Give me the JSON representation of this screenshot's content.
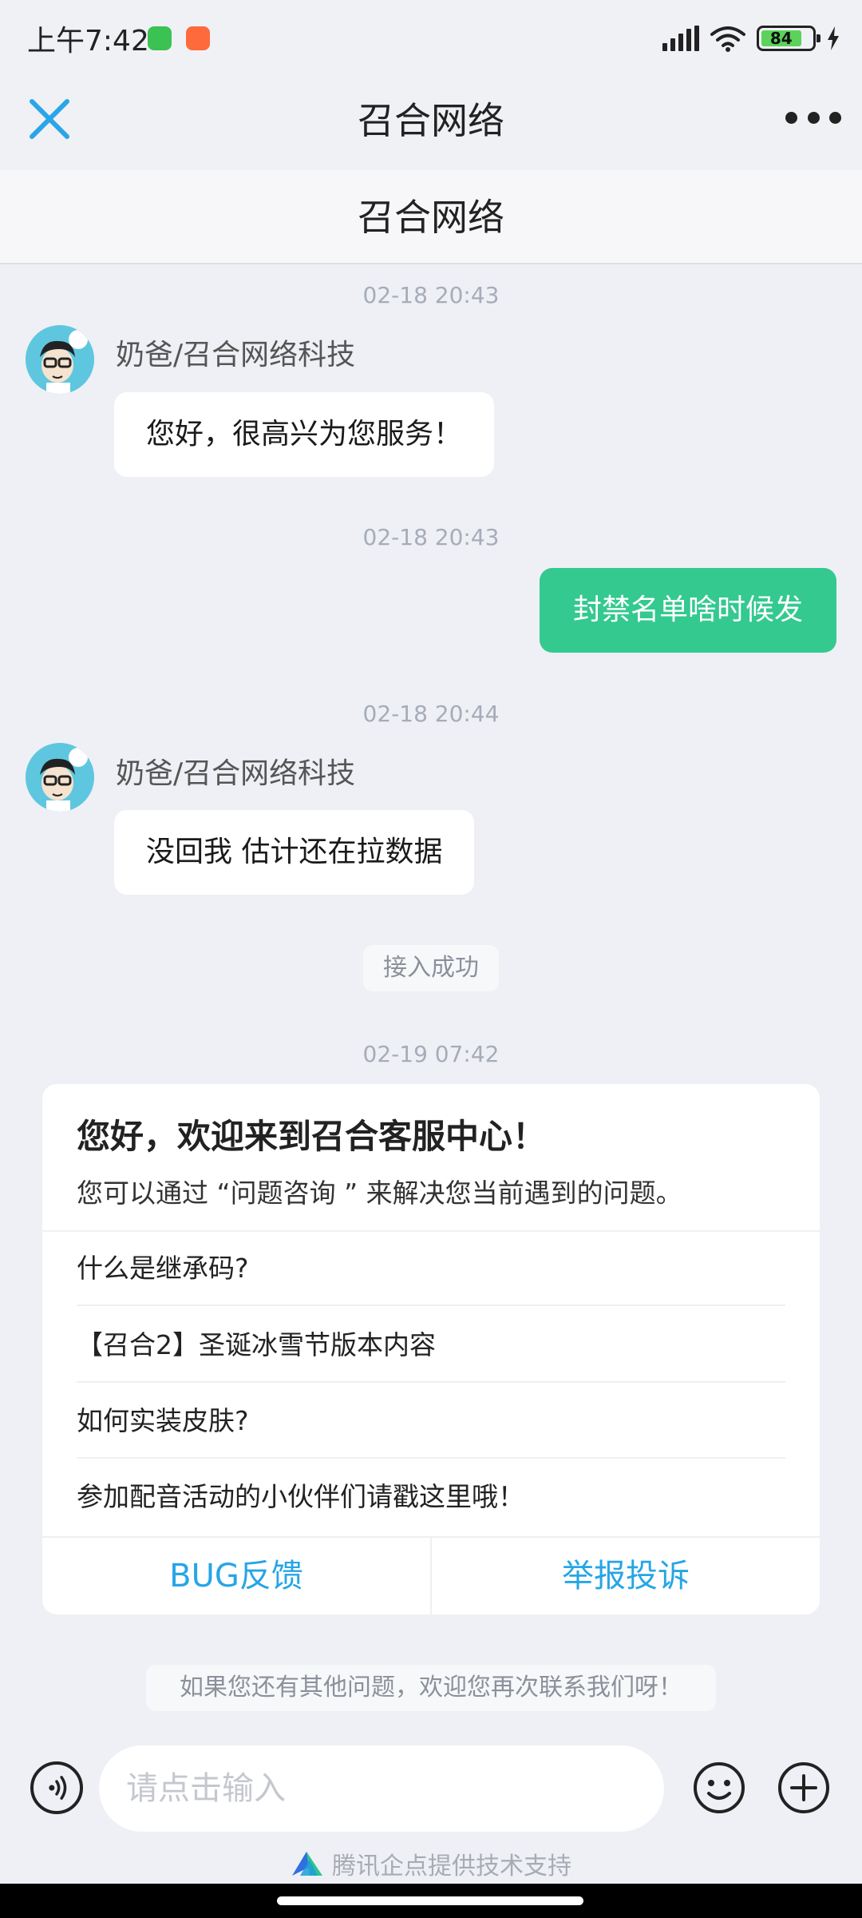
{
  "status": {
    "time": "上午7:42",
    "battery": "84"
  },
  "appbar": {
    "title": "召合网络"
  },
  "subheader": {
    "title": "召合网络"
  },
  "messages": [
    {
      "timestamp": "02-18 20:43",
      "sender": "奶爸/召合网络科技",
      "text": "您好，很高兴为您服务！"
    },
    {
      "timestamp": "02-18 20:43",
      "text": "封禁名单啥时候发"
    },
    {
      "timestamp": "02-18 20:44",
      "sender": "奶爸/召合网络科技",
      "text": "没回我 估计还在拉数据"
    }
  ],
  "system_notice": "接入成功",
  "card_timestamp": "02-19 07:42",
  "welcome_card": {
    "title": "您好，欢迎来到召合客服中心！",
    "subtitle": "您可以通过 “问题咨询 ” 来解决您当前遇到的问题。",
    "faq": [
      "什么是继承码?",
      "【召合2】圣诞冰雪节版本内容",
      "如何实装皮肤?",
      "参加配音活动的小伙伴们请戳这里哦！"
    ],
    "buttons": [
      "BUG反馈",
      "举报投诉"
    ]
  },
  "closing_notice": "如果您还有其他问题，欢迎您再次联系我们呀！",
  "input": {
    "placeholder": "请点击输入"
  },
  "footer": {
    "credit": "腾讯企点提供技术支持"
  },
  "colors": {
    "accent_green": "#34c98f",
    "link_blue": "#27a5e6",
    "background": "#eef0f5"
  }
}
